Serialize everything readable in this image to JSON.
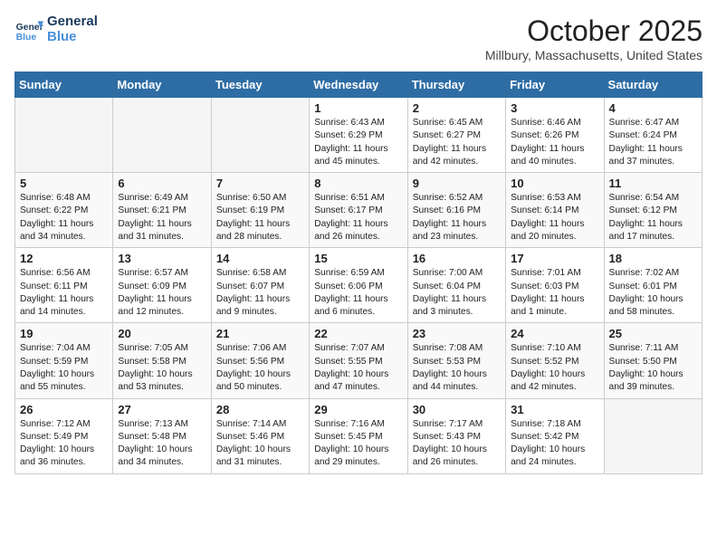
{
  "header": {
    "logo_line1": "General",
    "logo_line2": "Blue",
    "month": "October 2025",
    "location": "Millbury, Massachusetts, United States"
  },
  "days_of_week": [
    "Sunday",
    "Monday",
    "Tuesday",
    "Wednesday",
    "Thursday",
    "Friday",
    "Saturday"
  ],
  "weeks": [
    [
      {
        "day": "",
        "empty": true
      },
      {
        "day": "",
        "empty": true
      },
      {
        "day": "",
        "empty": true
      },
      {
        "day": "1",
        "lines": [
          "Sunrise: 6:43 AM",
          "Sunset: 6:29 PM",
          "Daylight: 11 hours",
          "and 45 minutes."
        ]
      },
      {
        "day": "2",
        "lines": [
          "Sunrise: 6:45 AM",
          "Sunset: 6:27 PM",
          "Daylight: 11 hours",
          "and 42 minutes."
        ]
      },
      {
        "day": "3",
        "lines": [
          "Sunrise: 6:46 AM",
          "Sunset: 6:26 PM",
          "Daylight: 11 hours",
          "and 40 minutes."
        ]
      },
      {
        "day": "4",
        "lines": [
          "Sunrise: 6:47 AM",
          "Sunset: 6:24 PM",
          "Daylight: 11 hours",
          "and 37 minutes."
        ]
      }
    ],
    [
      {
        "day": "5",
        "lines": [
          "Sunrise: 6:48 AM",
          "Sunset: 6:22 PM",
          "Daylight: 11 hours",
          "and 34 minutes."
        ]
      },
      {
        "day": "6",
        "lines": [
          "Sunrise: 6:49 AM",
          "Sunset: 6:21 PM",
          "Daylight: 11 hours",
          "and 31 minutes."
        ]
      },
      {
        "day": "7",
        "lines": [
          "Sunrise: 6:50 AM",
          "Sunset: 6:19 PM",
          "Daylight: 11 hours",
          "and 28 minutes."
        ]
      },
      {
        "day": "8",
        "lines": [
          "Sunrise: 6:51 AM",
          "Sunset: 6:17 PM",
          "Daylight: 11 hours",
          "and 26 minutes."
        ]
      },
      {
        "day": "9",
        "lines": [
          "Sunrise: 6:52 AM",
          "Sunset: 6:16 PM",
          "Daylight: 11 hours",
          "and 23 minutes."
        ]
      },
      {
        "day": "10",
        "lines": [
          "Sunrise: 6:53 AM",
          "Sunset: 6:14 PM",
          "Daylight: 11 hours",
          "and 20 minutes."
        ]
      },
      {
        "day": "11",
        "lines": [
          "Sunrise: 6:54 AM",
          "Sunset: 6:12 PM",
          "Daylight: 11 hours",
          "and 17 minutes."
        ]
      }
    ],
    [
      {
        "day": "12",
        "lines": [
          "Sunrise: 6:56 AM",
          "Sunset: 6:11 PM",
          "Daylight: 11 hours",
          "and 14 minutes."
        ]
      },
      {
        "day": "13",
        "lines": [
          "Sunrise: 6:57 AM",
          "Sunset: 6:09 PM",
          "Daylight: 11 hours",
          "and 12 minutes."
        ]
      },
      {
        "day": "14",
        "lines": [
          "Sunrise: 6:58 AM",
          "Sunset: 6:07 PM",
          "Daylight: 11 hours",
          "and 9 minutes."
        ]
      },
      {
        "day": "15",
        "lines": [
          "Sunrise: 6:59 AM",
          "Sunset: 6:06 PM",
          "Daylight: 11 hours",
          "and 6 minutes."
        ]
      },
      {
        "day": "16",
        "lines": [
          "Sunrise: 7:00 AM",
          "Sunset: 6:04 PM",
          "Daylight: 11 hours",
          "and 3 minutes."
        ]
      },
      {
        "day": "17",
        "lines": [
          "Sunrise: 7:01 AM",
          "Sunset: 6:03 PM",
          "Daylight: 11 hours",
          "and 1 minute."
        ]
      },
      {
        "day": "18",
        "lines": [
          "Sunrise: 7:02 AM",
          "Sunset: 6:01 PM",
          "Daylight: 10 hours",
          "and 58 minutes."
        ]
      }
    ],
    [
      {
        "day": "19",
        "lines": [
          "Sunrise: 7:04 AM",
          "Sunset: 5:59 PM",
          "Daylight: 10 hours",
          "and 55 minutes."
        ]
      },
      {
        "day": "20",
        "lines": [
          "Sunrise: 7:05 AM",
          "Sunset: 5:58 PM",
          "Daylight: 10 hours",
          "and 53 minutes."
        ]
      },
      {
        "day": "21",
        "lines": [
          "Sunrise: 7:06 AM",
          "Sunset: 5:56 PM",
          "Daylight: 10 hours",
          "and 50 minutes."
        ]
      },
      {
        "day": "22",
        "lines": [
          "Sunrise: 7:07 AM",
          "Sunset: 5:55 PM",
          "Daylight: 10 hours",
          "and 47 minutes."
        ]
      },
      {
        "day": "23",
        "lines": [
          "Sunrise: 7:08 AM",
          "Sunset: 5:53 PM",
          "Daylight: 10 hours",
          "and 44 minutes."
        ]
      },
      {
        "day": "24",
        "lines": [
          "Sunrise: 7:10 AM",
          "Sunset: 5:52 PM",
          "Daylight: 10 hours",
          "and 42 minutes."
        ]
      },
      {
        "day": "25",
        "lines": [
          "Sunrise: 7:11 AM",
          "Sunset: 5:50 PM",
          "Daylight: 10 hours",
          "and 39 minutes."
        ]
      }
    ],
    [
      {
        "day": "26",
        "lines": [
          "Sunrise: 7:12 AM",
          "Sunset: 5:49 PM",
          "Daylight: 10 hours",
          "and 36 minutes."
        ]
      },
      {
        "day": "27",
        "lines": [
          "Sunrise: 7:13 AM",
          "Sunset: 5:48 PM",
          "Daylight: 10 hours",
          "and 34 minutes."
        ]
      },
      {
        "day": "28",
        "lines": [
          "Sunrise: 7:14 AM",
          "Sunset: 5:46 PM",
          "Daylight: 10 hours",
          "and 31 minutes."
        ]
      },
      {
        "day": "29",
        "lines": [
          "Sunrise: 7:16 AM",
          "Sunset: 5:45 PM",
          "Daylight: 10 hours",
          "and 29 minutes."
        ]
      },
      {
        "day": "30",
        "lines": [
          "Sunrise: 7:17 AM",
          "Sunset: 5:43 PM",
          "Daylight: 10 hours",
          "and 26 minutes."
        ]
      },
      {
        "day": "31",
        "lines": [
          "Sunrise: 7:18 AM",
          "Sunset: 5:42 PM",
          "Daylight: 10 hours",
          "and 24 minutes."
        ]
      },
      {
        "day": "",
        "empty": true
      }
    ]
  ]
}
